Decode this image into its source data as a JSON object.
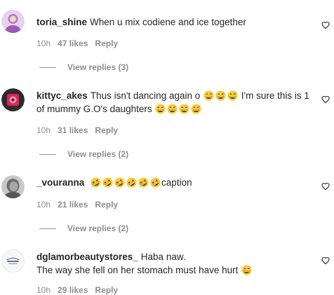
{
  "comments": [
    {
      "username": "toria_shine",
      "text": "When u mix codiene and ice together",
      "time": "10h",
      "likes": "47 likes",
      "reply_label": "Reply",
      "view_replies": "View replies (3)",
      "avatar_color": "#c39bd3"
    },
    {
      "username": "kittyc_akes",
      "text_part1": "Thus isn't dancing again o",
      "text_part2": "I'm sure this is 1 of mummy G.O's daughters",
      "emojis_part1": [
        "grinning-sweat-emoji",
        "grinning-sweat-emoji",
        "grinning-sweat-emoji"
      ],
      "emojis_part2": [
        "grinning-sweat-emoji",
        "grinning-sweat-emoji",
        "grinning-sweat-emoji",
        "grinning-sweat-emoji"
      ],
      "time": "10h",
      "likes": "31 likes",
      "reply_label": "Reply",
      "view_replies": "View replies (2)",
      "avatar_color": "#e0245e"
    },
    {
      "username": "_vouranna",
      "emojis": [
        "rolling-laughing-emoji",
        "rolling-laughing-emoji",
        "rolling-laughing-emoji",
        "rolling-laughing-emoji",
        "rolling-laughing-emoji",
        "rolling-laughing-emoji"
      ],
      "text": "caption",
      "time": "10h",
      "likes": "21 likes",
      "reply_label": "Reply",
      "view_replies": "View replies (2)",
      "avatar_color": "#9a9a9a"
    },
    {
      "username": "dglamorbeautystores_",
      "text_line1": "Haba naw.",
      "text_line2": "The way she fell on her stomach must have hurt",
      "emojis": [
        "grinning-sweat-emoji"
      ],
      "time": "10h",
      "likes": "29 likes",
      "reply_label": "Reply",
      "avatar_color": "#e8e8e8"
    }
  ],
  "colors": {
    "text": "#262626",
    "muted": "#8e8e8e",
    "background": "#ffffff"
  }
}
